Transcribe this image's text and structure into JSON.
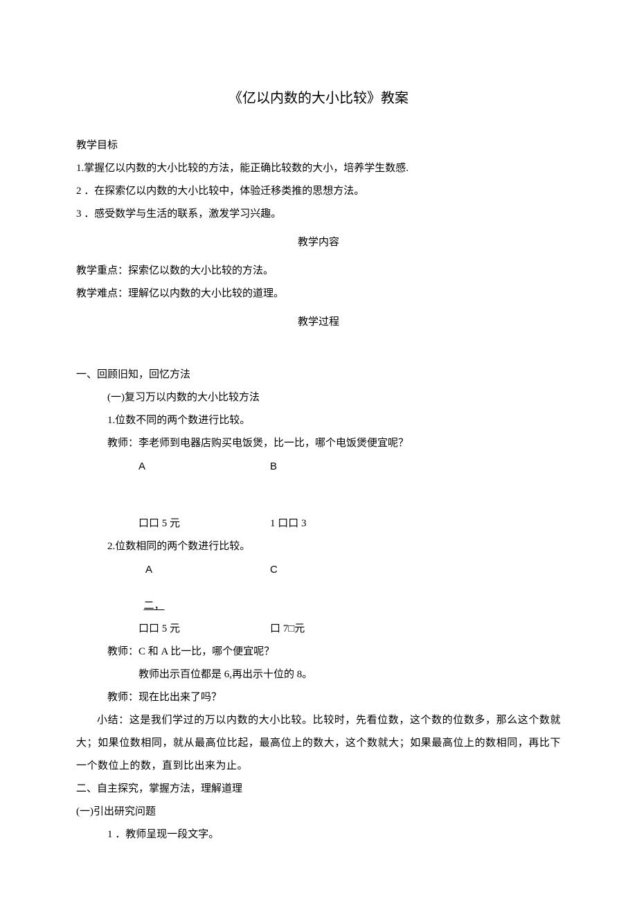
{
  "title": "《亿以内数的大小比较》教案",
  "goals_heading": "教学目标",
  "goal_1": "1.掌握亿以内数的大小比较的方法，能正确比较数的大小，培养学生数感.",
  "goal_2": "2 ．在探索亿以内数的大小比较中，体验迁移类推的思想方法。",
  "goal_3": "3 ．感受数学与生活的联系，激发学习兴趣。",
  "content_heading": "教学内容",
  "focus": "教学重点：探索亿以数的大小比较的方法。",
  "difficulty": "教学难点：理解亿以内数的大小比较的道理。",
  "process_heading": "教学过程",
  "section1": "一、回顾旧知，回忆方法",
  "section1_sub": "(一)复习万以内数的大小比较方法",
  "section1_item1": "1.位数不同的两个数进行比较。",
  "section1_teacher1": "教师：李老师到电器店购买电饭煲，比一比，哪个电饭煲便宜呢？",
  "label_A": "A",
  "label_B": "B",
  "price_A": "口口 5 元",
  "price_B": "1 口口 3",
  "section1_item2": "2.位数相同的两个数进行比较。",
  "label_A2": "A",
  "label_C": "C",
  "two_label": "二，",
  "price_A2": "口口 5 元",
  "price_C": "口 7□元",
  "section1_teacher2": "教师：C 和 A 比一比，哪个便宜呢？",
  "section1_teacher2_sub": "教师出示百位都是 6,再出示十位的 8。",
  "section1_teacher3": "教师：现在比出来了吗？",
  "section1_summary": "小结：这是我们学过的万以内数的大小比较。比较时，先看位数，这个数的位数多，那么这个数就大；如果位数相同，就从最高位比起，最高位上的数大，这个数就大；如果最高位上的数相同，再比下一个数位上的数，直到比出来为止。",
  "section2": "二、自主探究，掌握方法，理解道理",
  "section2_sub": "(一)引出研究问题",
  "section2_item1": "1 ．教师呈现一段文字。"
}
